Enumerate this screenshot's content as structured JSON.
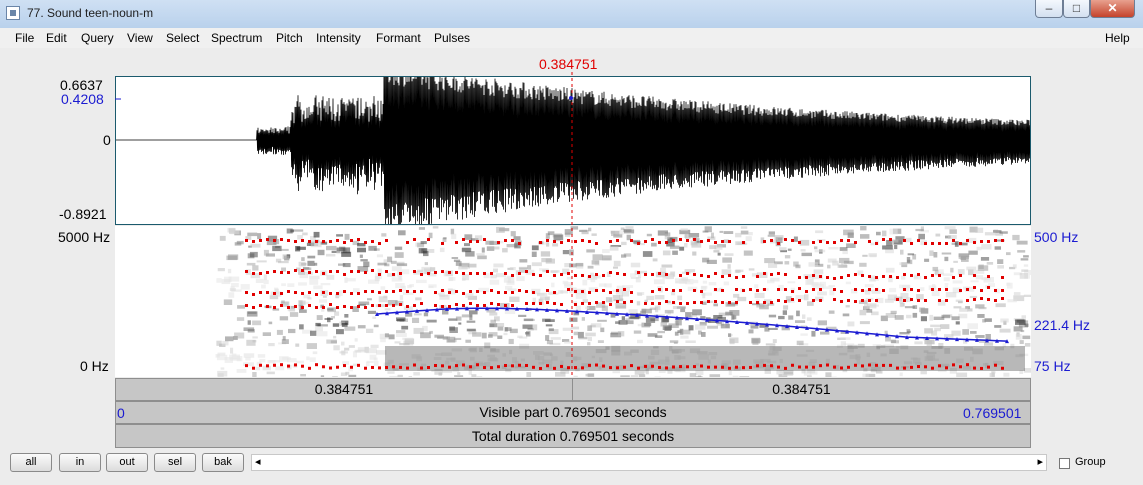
{
  "window": {
    "title": "77. Sound teen-noun-m",
    "controls": {
      "minimize": "–",
      "maximize": "□",
      "close": "✕"
    }
  },
  "menu": [
    "File",
    "Edit",
    "Query",
    "View",
    "Select",
    "Spectrum",
    "Pitch",
    "Intensity",
    "Formant",
    "Pulses"
  ],
  "help": "Help",
  "cursor_time": "0.384751",
  "waveform": {
    "y_max": "0.6637",
    "y_cursor_value": "0.4208",
    "y_zero": "0",
    "y_min": "-0.8921"
  },
  "spectrogram": {
    "freq_top": "5000 Hz",
    "freq_bottom": "0 Hz",
    "pitch_top": "500 Hz",
    "pitch_cursor": "221.4 Hz",
    "pitch_bottom": "75 Hz"
  },
  "intervals": {
    "left": "0.384751",
    "right": "0.384751"
  },
  "visible": {
    "start": "0",
    "label": "Visible part 0.769501 seconds",
    "end": "0.769501"
  },
  "total": {
    "label": "Total duration 0.769501 seconds"
  },
  "buttons": {
    "all": "all",
    "in": "in",
    "out": "out",
    "sel": "sel",
    "bak": "bak"
  },
  "scroll": {
    "left_arrow": "◂",
    "right_arrow": "▸"
  },
  "group_label": "Group",
  "colors": {
    "formant": "#e00000",
    "pitch": "#1b1bd1",
    "cursor": "#e00000",
    "axis_blue": "#1b1bd1"
  }
}
